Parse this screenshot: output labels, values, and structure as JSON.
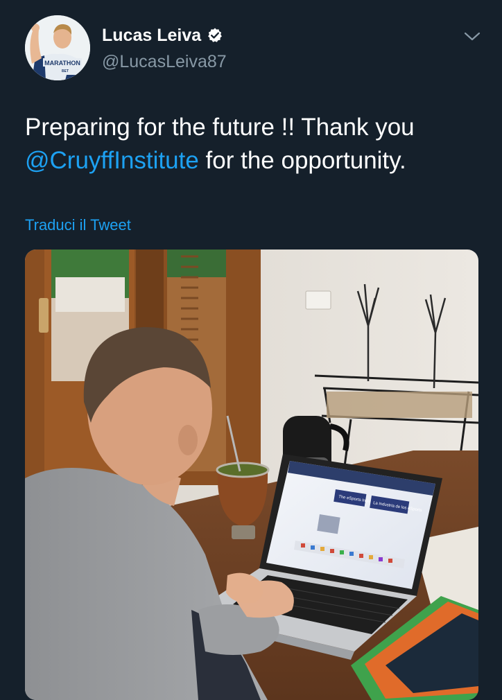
{
  "tweet": {
    "author": {
      "display_name": "Lucas Leiva",
      "handle": "@LucasLeiva87",
      "verified": true,
      "avatar_icon": "profile-photo",
      "jersey_text": "MARATHON",
      "jersey_subtext": "BET"
    },
    "menu_icon": "chevron-down-icon",
    "text_before": "Preparing for the future !! Thank you",
    "mention": "@CruyffInstitute",
    "text_after": " for the opportunity.",
    "translate_label": "Traduci il Tweet",
    "media": {
      "laptop_banner_left": "The eSports Industry",
      "laptop_banner_right": "La industria de los eSports"
    }
  },
  "colors": {
    "background": "#15202b",
    "text": "#ffffff",
    "secondary_text": "#8899a6",
    "link": "#1da1f2"
  }
}
